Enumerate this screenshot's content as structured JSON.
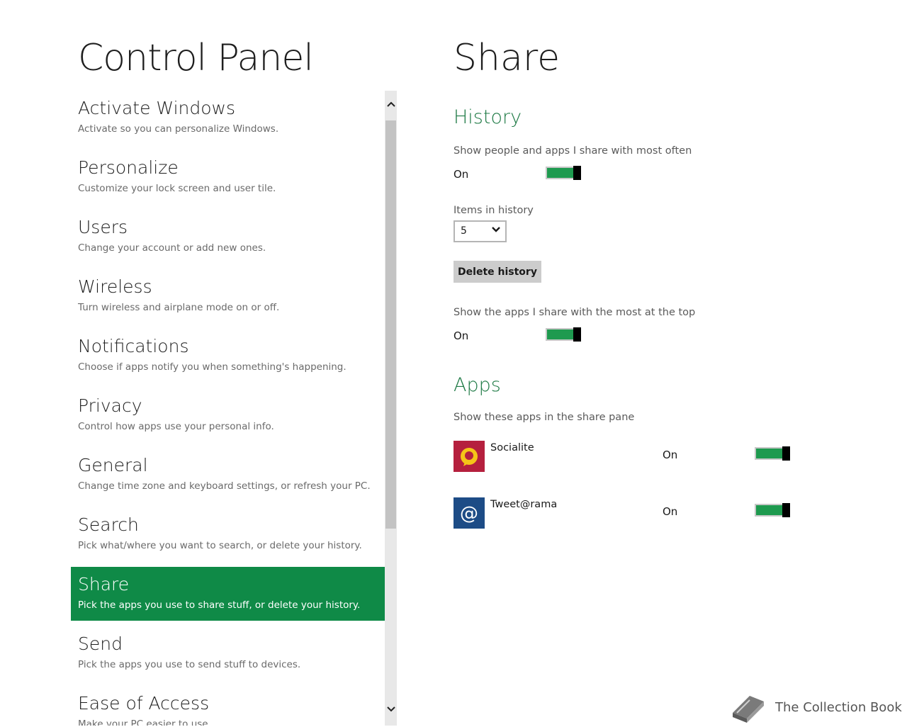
{
  "left": {
    "title": "Control Panel",
    "items": [
      {
        "title": "Activate Windows",
        "subtitle": "Activate so you can personalize Windows."
      },
      {
        "title": "Personalize",
        "subtitle": "Customize your lock screen and user tile."
      },
      {
        "title": "Users",
        "subtitle": "Change your account or add new ones."
      },
      {
        "title": "Wireless",
        "subtitle": "Turn wireless and airplane mode on or off."
      },
      {
        "title": "Notifications",
        "subtitle": "Choose if apps notify you when something's happening."
      },
      {
        "title": "Privacy",
        "subtitle": "Control how apps use your personal info."
      },
      {
        "title": "General",
        "subtitle": "Change time zone and keyboard settings, or refresh your PC."
      },
      {
        "title": "Search",
        "subtitle": "Pick what/where you want to search, or delete your history."
      },
      {
        "title": "Share",
        "subtitle": "Pick the apps you use to share stuff, or delete your history.",
        "active": true
      },
      {
        "title": "Send",
        "subtitle": "Pick the apps you use to send stuff to devices."
      },
      {
        "title": "Ease of Access",
        "subtitle": "Make your PC easier to use."
      }
    ]
  },
  "right": {
    "title": "Share",
    "history": {
      "heading": "History",
      "show_people_label": "Show people and apps I share with most often",
      "show_people_state": "On",
      "items_label": "Items in history",
      "items_value": "5",
      "delete_label": "Delete history",
      "top_apps_label": "Show the apps I share with the most at the top",
      "top_apps_state": "On"
    },
    "apps": {
      "heading": "Apps",
      "label": "Show these apps in the share pane",
      "list": [
        {
          "name": "Socialite",
          "state": "On",
          "icon": "socialite-icon",
          "color": "#b5203e"
        },
        {
          "name": "Tweet@rama",
          "state": "On",
          "icon": "tweetarama-icon",
          "color": "#1d4c86"
        }
      ]
    }
  },
  "watermark": {
    "text": "The Collection Book"
  },
  "colors": {
    "accent": "#0f8a47",
    "section": "#1e7a45",
    "toggle_on": "#1e9a4f"
  }
}
